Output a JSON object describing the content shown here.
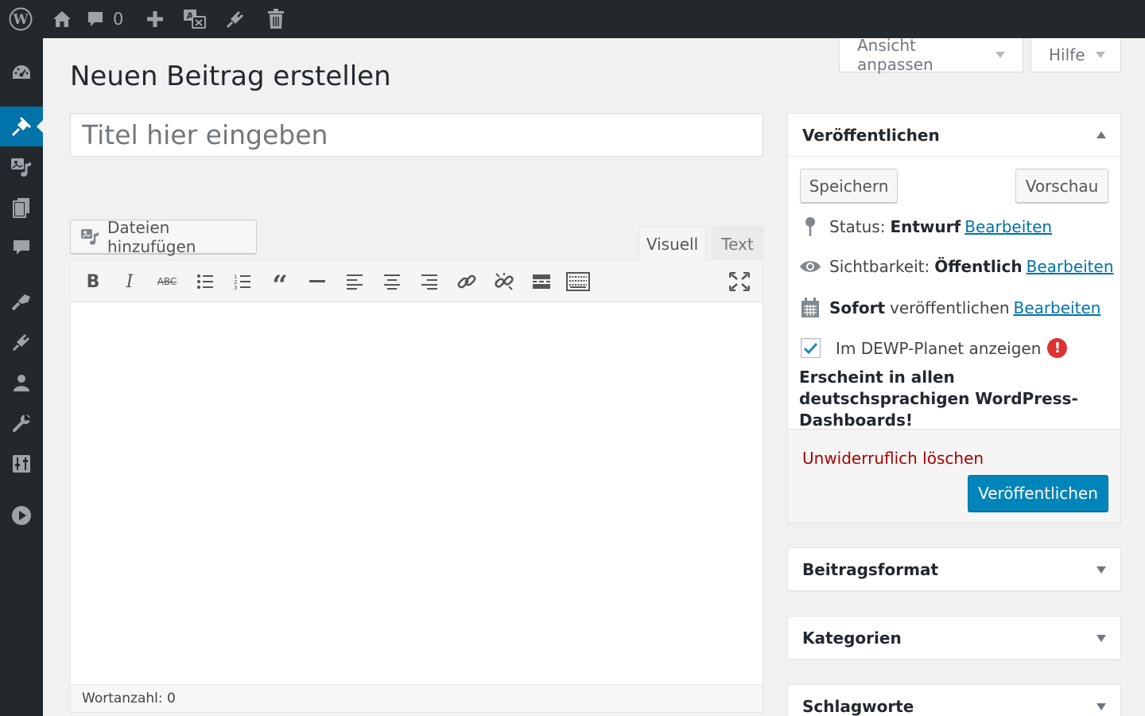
{
  "adminbar": {
    "comments_count": "0",
    "icons": [
      "wordpress-logo-icon",
      "home-icon",
      "comment-icon",
      "plus-icon",
      "translate-icon",
      "plugin-icon",
      "trash-icon"
    ]
  },
  "adminmenu": {
    "icons": [
      "dashboard-icon",
      "pin-icon",
      "media-icon",
      "pages-icon",
      "comments-icon",
      "appearance-icon",
      "plugins-icon",
      "users-icon",
      "tools-icon",
      "settings-icon",
      "play-icon"
    ],
    "current": "pin-icon"
  },
  "screen_meta": {
    "screen_options": "Ansicht anpassen",
    "help": "Hilfe"
  },
  "page": {
    "title": "Neuen Beitrag erstellen"
  },
  "post_title": {
    "placeholder": "Titel hier eingeben"
  },
  "editor": {
    "add_media": "Dateien hinzufügen",
    "tab_visual": "Visuell",
    "tab_text": "Text",
    "toolbar": [
      "bold",
      "italic",
      "strikethrough",
      "bulleted-list",
      "numbered-list",
      "blockquote",
      "horizontal-line",
      "align-left",
      "align-center",
      "align-right",
      "insert-link",
      "remove-link",
      "read-more",
      "toolbar-toggle",
      "fullscreen"
    ],
    "word_count": "Wortanzahl: 0"
  },
  "publish_box": {
    "title": "Veröffentlichen",
    "save": "Speichern",
    "preview": "Vorschau",
    "status_label": "Status:",
    "status_value": "Entwurf",
    "visibility_label": "Sichtbarkeit:",
    "visibility_value": "Öffentlich",
    "schedule_strong": "Sofort",
    "schedule_label": "veröffentlichen",
    "edit": "Bearbeiten",
    "planet_checkbox": "Im DEWP-Planet anzeigen",
    "planet_checked": true,
    "planet_note": "Erscheint in allen deutschsprachigen WordPress-Dashboards!",
    "delete": "Unwiderruflich löschen",
    "publish": "Veröffentlichen"
  },
  "boxes": {
    "format": "Beitragsformat",
    "categories": "Kategorien",
    "tags": "Schlagworte"
  },
  "colors": {
    "admin_dark": "#23282d",
    "accent": "#0073aa",
    "publish_button": "#0085ba",
    "delete_link": "#aa0000",
    "warning": "#dc3232"
  }
}
